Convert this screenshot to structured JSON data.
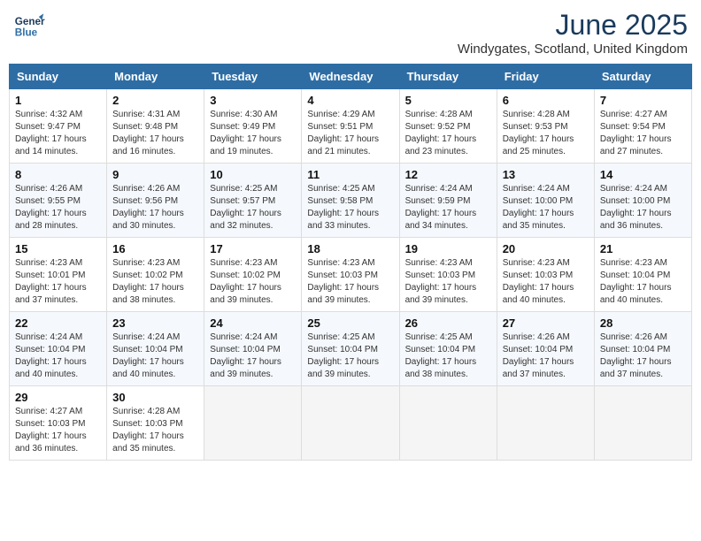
{
  "header": {
    "logo_line1": "General",
    "logo_line2": "Blue",
    "month_year": "June 2025",
    "location": "Windygates, Scotland, United Kingdom"
  },
  "weekdays": [
    "Sunday",
    "Monday",
    "Tuesday",
    "Wednesday",
    "Thursday",
    "Friday",
    "Saturday"
  ],
  "weeks": [
    [
      {
        "day": "1",
        "sunrise": "4:32 AM",
        "sunset": "9:47 PM",
        "daylight": "17 hours and 14 minutes."
      },
      {
        "day": "2",
        "sunrise": "4:31 AM",
        "sunset": "9:48 PM",
        "daylight": "17 hours and 16 minutes."
      },
      {
        "day": "3",
        "sunrise": "4:30 AM",
        "sunset": "9:49 PM",
        "daylight": "17 hours and 19 minutes."
      },
      {
        "day": "4",
        "sunrise": "4:29 AM",
        "sunset": "9:51 PM",
        "daylight": "17 hours and 21 minutes."
      },
      {
        "day": "5",
        "sunrise": "4:28 AM",
        "sunset": "9:52 PM",
        "daylight": "17 hours and 23 minutes."
      },
      {
        "day": "6",
        "sunrise": "4:28 AM",
        "sunset": "9:53 PM",
        "daylight": "17 hours and 25 minutes."
      },
      {
        "day": "7",
        "sunrise": "4:27 AM",
        "sunset": "9:54 PM",
        "daylight": "17 hours and 27 minutes."
      }
    ],
    [
      {
        "day": "8",
        "sunrise": "4:26 AM",
        "sunset": "9:55 PM",
        "daylight": "17 hours and 28 minutes."
      },
      {
        "day": "9",
        "sunrise": "4:26 AM",
        "sunset": "9:56 PM",
        "daylight": "17 hours and 30 minutes."
      },
      {
        "day": "10",
        "sunrise": "4:25 AM",
        "sunset": "9:57 PM",
        "daylight": "17 hours and 32 minutes."
      },
      {
        "day": "11",
        "sunrise": "4:25 AM",
        "sunset": "9:58 PM",
        "daylight": "17 hours and 33 minutes."
      },
      {
        "day": "12",
        "sunrise": "4:24 AM",
        "sunset": "9:59 PM",
        "daylight": "17 hours and 34 minutes."
      },
      {
        "day": "13",
        "sunrise": "4:24 AM",
        "sunset": "10:00 PM",
        "daylight": "17 hours and 35 minutes."
      },
      {
        "day": "14",
        "sunrise": "4:24 AM",
        "sunset": "10:00 PM",
        "daylight": "17 hours and 36 minutes."
      }
    ],
    [
      {
        "day": "15",
        "sunrise": "4:23 AM",
        "sunset": "10:01 PM",
        "daylight": "17 hours and 37 minutes."
      },
      {
        "day": "16",
        "sunrise": "4:23 AM",
        "sunset": "10:02 PM",
        "daylight": "17 hours and 38 minutes."
      },
      {
        "day": "17",
        "sunrise": "4:23 AM",
        "sunset": "10:02 PM",
        "daylight": "17 hours and 39 minutes."
      },
      {
        "day": "18",
        "sunrise": "4:23 AM",
        "sunset": "10:03 PM",
        "daylight": "17 hours and 39 minutes."
      },
      {
        "day": "19",
        "sunrise": "4:23 AM",
        "sunset": "10:03 PM",
        "daylight": "17 hours and 39 minutes."
      },
      {
        "day": "20",
        "sunrise": "4:23 AM",
        "sunset": "10:03 PM",
        "daylight": "17 hours and 40 minutes."
      },
      {
        "day": "21",
        "sunrise": "4:23 AM",
        "sunset": "10:04 PM",
        "daylight": "17 hours and 40 minutes."
      }
    ],
    [
      {
        "day": "22",
        "sunrise": "4:24 AM",
        "sunset": "10:04 PM",
        "daylight": "17 hours and 40 minutes."
      },
      {
        "day": "23",
        "sunrise": "4:24 AM",
        "sunset": "10:04 PM",
        "daylight": "17 hours and 40 minutes."
      },
      {
        "day": "24",
        "sunrise": "4:24 AM",
        "sunset": "10:04 PM",
        "daylight": "17 hours and 39 minutes."
      },
      {
        "day": "25",
        "sunrise": "4:25 AM",
        "sunset": "10:04 PM",
        "daylight": "17 hours and 39 minutes."
      },
      {
        "day": "26",
        "sunrise": "4:25 AM",
        "sunset": "10:04 PM",
        "daylight": "17 hours and 38 minutes."
      },
      {
        "day": "27",
        "sunrise": "4:26 AM",
        "sunset": "10:04 PM",
        "daylight": "17 hours and 37 minutes."
      },
      {
        "day": "28",
        "sunrise": "4:26 AM",
        "sunset": "10:04 PM",
        "daylight": "17 hours and 37 minutes."
      }
    ],
    [
      {
        "day": "29",
        "sunrise": "4:27 AM",
        "sunset": "10:03 PM",
        "daylight": "17 hours and 36 minutes."
      },
      {
        "day": "30",
        "sunrise": "4:28 AM",
        "sunset": "10:03 PM",
        "daylight": "17 hours and 35 minutes."
      },
      null,
      null,
      null,
      null,
      null
    ]
  ],
  "labels": {
    "sunrise": "Sunrise:",
    "sunset": "Sunset:",
    "daylight": "Daylight:"
  }
}
